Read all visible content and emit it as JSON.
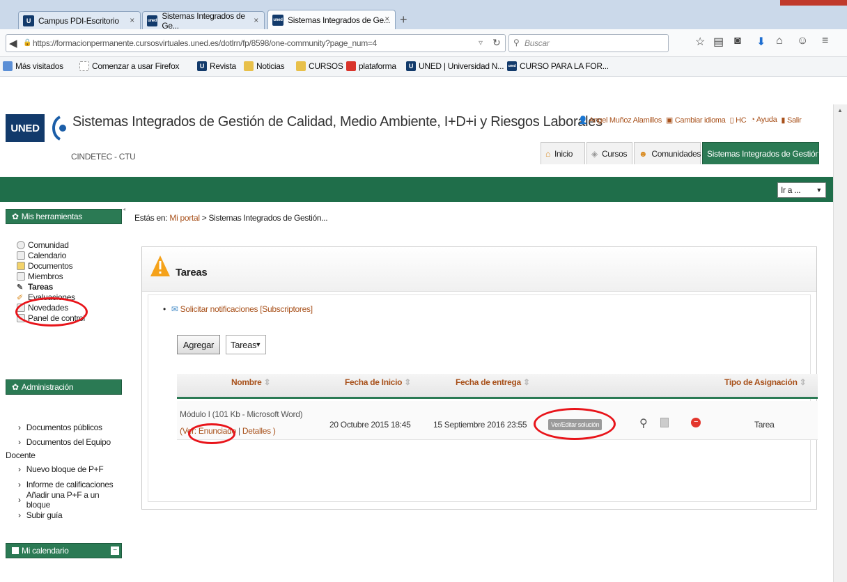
{
  "browser": {
    "tabs": [
      {
        "label": "Campus PDI-Escritorio",
        "icon": "U",
        "icon_color": "#123a6b"
      },
      {
        "label": "Sistemas Integrados de Ge...",
        "icon": "uned",
        "icon_color": "#123a6b"
      },
      {
        "label": "Sistemas Integrados de Ge...",
        "icon": "uned",
        "icon_color": "#123a6b"
      }
    ],
    "url": "https://formacionpermanente.cursosvirtuales.uned.es/dotlrn/fp/8598/one-community?page_num=4",
    "search_placeholder": "Buscar",
    "bookmarks": [
      {
        "label": "Más visitados"
      },
      {
        "label": "Comenzar a usar Firefox"
      },
      {
        "label": "Revista"
      },
      {
        "label": "Noticias"
      },
      {
        "label": "CURSOS"
      },
      {
        "label": "plataforma"
      },
      {
        "label": "UNED | Universidad N..."
      },
      {
        "label": "CURSO PARA LA FOR..."
      }
    ]
  },
  "header": {
    "logo": "UNED",
    "org": "CINDETEC - CTU",
    "title": "Sistemas Integrados de Gestión de Calidad, Medio Ambiente, I+D+i y Riesgos Laborales",
    "user_links": [
      "Angel Muñoz Alamillos",
      "Cambiar idioma",
      "HC",
      "Ayuda",
      "Salir"
    ],
    "nav_tabs": [
      "Inicio",
      "Cursos",
      "Comunidades",
      "Sistemas Integrados de Gestión..."
    ],
    "goto": "Ir a ..."
  },
  "sidebar": {
    "tools_title": "Mis herramientas",
    "tools": [
      "Comunidad",
      "Calendario",
      "Documentos",
      "Miembros",
      "Tareas",
      "Evaluaciones",
      "Novedades",
      "Panel de control"
    ],
    "admin_title": "Administración",
    "admin_items": [
      "Documentos públicos",
      "Documentos del Equipo",
      "Docente",
      "Nuevo bloque de P+F",
      "Informe de calificaciones",
      "Añadir una P+F a un bloque",
      "Subir guía"
    ],
    "calendar_title": "Mi calendario"
  },
  "main": {
    "breadcrumb_prefix": "Estás en:",
    "breadcrumb_link": "Mi portal",
    "breadcrumb_rest": " > Sistemas Integrados de Gestión...",
    "panel_title": "Tareas",
    "notify_link": "Solicitar notificaciones",
    "subscribers_link": "[Subscriptores]",
    "add_button": "Agregar",
    "select_value": "Tareas",
    "columns": [
      "Nombre",
      "Fecha de Inicio",
      "Fecha de entrega",
      "Tipo de Asignación"
    ],
    "row": {
      "name": "Módulo I (101 Kb - Microsoft Word)",
      "ver_prefix": "(Ver:",
      "enunciado": "Enunciado",
      "sep": "|",
      "detalles": "Detalles",
      "close": ")",
      "start": "20 Octubre 2015 18:45",
      "due": "15 Septiembre 2016 23:55",
      "solution_button": "Ver/Editar solución",
      "type": "Tarea"
    }
  }
}
